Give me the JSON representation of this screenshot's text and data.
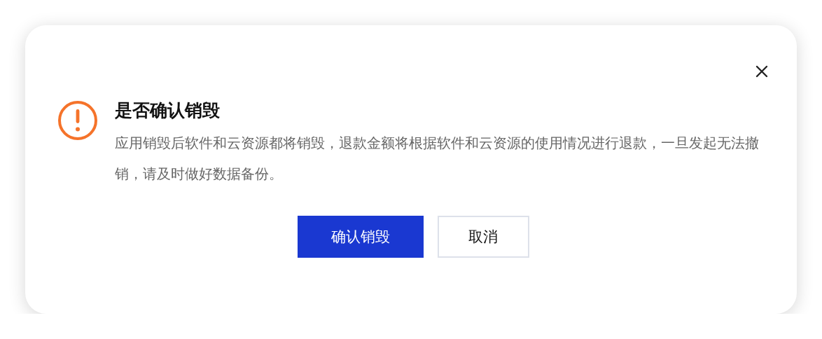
{
  "dialog": {
    "kind": "warning",
    "title": "是否确认销毁",
    "message": "应用销毁后软件和云资源都将销毁，退款金额将根据软件和云资源的使用情况进行退款，一旦发起无法撤销，请及时做好数据备份。",
    "buttons": [
      {
        "label": "确认销毁",
        "kind": "primary"
      },
      {
        "label": "取消",
        "kind": "default"
      }
    ]
  }
}
